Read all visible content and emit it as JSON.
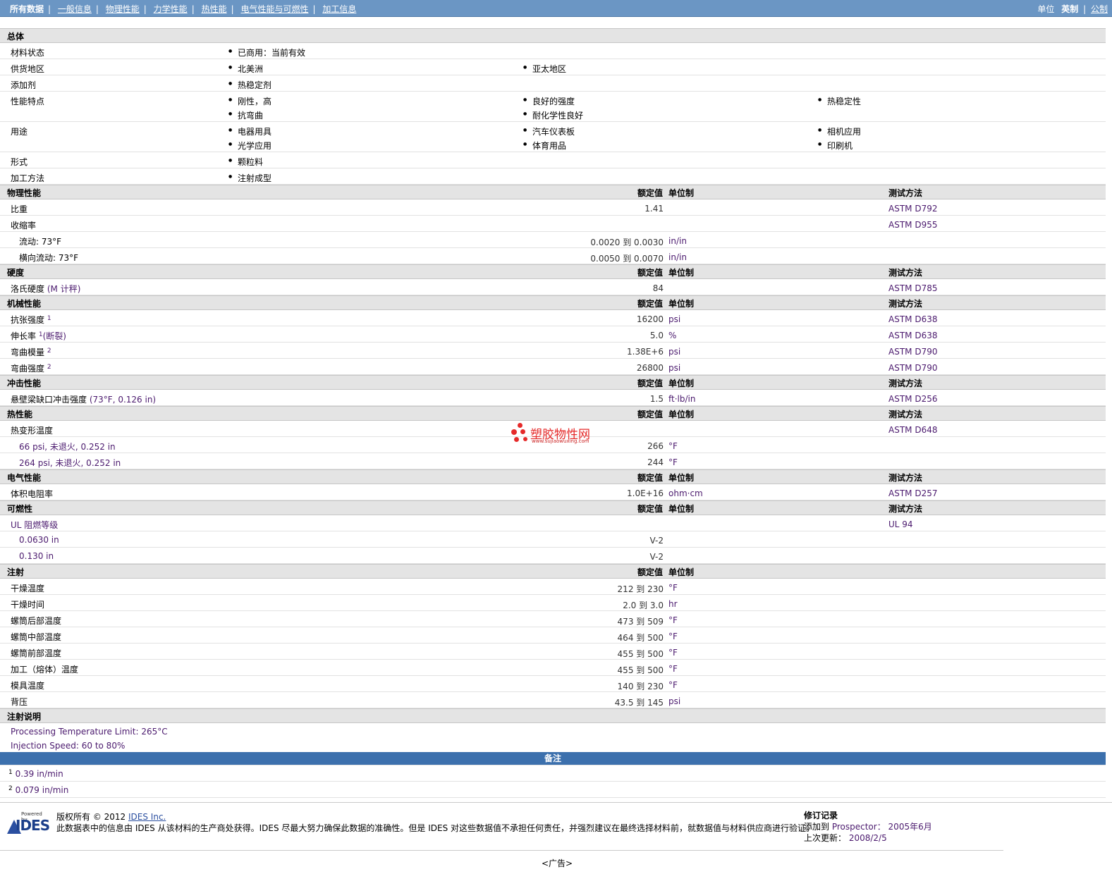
{
  "nav": {
    "items": [
      "所有数据",
      "一般信息",
      "物理性能",
      "力学性能",
      "热性能",
      "电气性能与可燃性",
      "加工信息"
    ],
    "units_label": "单位",
    "unit_current": "英制",
    "unit_other": "公制"
  },
  "headers": {
    "value": "额定值",
    "unit": "单位制",
    "test": "测试方法"
  },
  "general": {
    "title": "总体",
    "rows": [
      {
        "label": "材料状态",
        "items": [
          "已商用：当前有效"
        ]
      },
      {
        "label": "供货地区",
        "items": [
          "北美洲",
          "亚太地区"
        ]
      },
      {
        "label": "添加剂",
        "items": [
          "热稳定剂"
        ]
      },
      {
        "label": "性能特点",
        "items": [
          "刚性，高",
          "良好的强度",
          "热稳定性",
          "抗弯曲",
          "耐化学性良好"
        ]
      },
      {
        "label": "用途",
        "items": [
          "电器用具",
          "汽车仪表板",
          "相机应用",
          "光学应用",
          "体育用品",
          "印刷机"
        ]
      },
      {
        "label": "形式",
        "items": [
          "颗粒料"
        ]
      },
      {
        "label": "加工方法",
        "items": [
          "注射成型"
        ]
      }
    ]
  },
  "physical": {
    "title": "物理性能",
    "rows": [
      {
        "label": "比重",
        "value": "1.41",
        "unit": "",
        "test": "ASTM D792"
      },
      {
        "label": "收缩率",
        "value": "",
        "unit": "",
        "test": "ASTM D955"
      },
      {
        "label": "流动: 73°F",
        "value": "0.0020 到  0.0030",
        "unit": "in/in",
        "test": ""
      },
      {
        "label": "横向流动: 73°F",
        "value": "0.0050 到  0.0070",
        "unit": "in/in",
        "test": ""
      }
    ]
  },
  "hardness": {
    "title": "硬度",
    "rows": [
      {
        "label": "洛氏硬度",
        "extra": "(M 计秤)",
        "value": "84",
        "unit": "",
        "test": "ASTM D785"
      }
    ]
  },
  "mechanical": {
    "title": "机械性能",
    "rows": [
      {
        "label": "抗张强度",
        "sup": "1",
        "extra": "",
        "value": "16200",
        "unit": "psi",
        "test": "ASTM D638"
      },
      {
        "label": "伸长率",
        "sup": "1",
        "extra": "(断裂)",
        "value": "5.0",
        "unit": "%",
        "test": "ASTM D638"
      },
      {
        "label": "弯曲模量",
        "sup": "2",
        "extra": "",
        "value": "1.38E+6",
        "unit": "psi",
        "test": "ASTM D790"
      },
      {
        "label": "弯曲强度",
        "sup": "2",
        "extra": "",
        "value": "26800",
        "unit": "psi",
        "test": "ASTM D790"
      }
    ]
  },
  "impact": {
    "title": "冲击性能",
    "rows": [
      {
        "label": "悬壁梁缺口冲击强度",
        "extra": "(73°F, 0.126 in)",
        "value": "1.5",
        "unit": "ft·lb/in",
        "test": "ASTM D256"
      }
    ]
  },
  "thermal": {
    "title": "热性能",
    "rows": [
      {
        "label": "热变形温度",
        "value": "",
        "unit": "",
        "test": "ASTM D648"
      },
      {
        "label": "66 psi, 未退火, 0.252 in",
        "value": "266",
        "unit": "°F",
        "test": ""
      },
      {
        "label": "264 psi, 未退火, 0.252 in",
        "value": "244",
        "unit": "°F",
        "test": ""
      }
    ]
  },
  "electrical": {
    "title": "电气性能",
    "rows": [
      {
        "label": "体积电阻率",
        "value": "1.0E+16",
        "unit": "ohm·cm",
        "test": "ASTM D257"
      }
    ]
  },
  "flammability": {
    "title": "可燃性",
    "rows": [
      {
        "label": "UL 阻燃等级",
        "value": "",
        "unit": "",
        "test": "UL 94"
      },
      {
        "label": "0.0630 in",
        "value": "V-2",
        "unit": "",
        "test": ""
      },
      {
        "label": "0.130 in",
        "value": "V-2",
        "unit": "",
        "test": ""
      }
    ]
  },
  "injection": {
    "title": "注射",
    "rows": [
      {
        "label": "干燥温度",
        "value": "212 到  230",
        "unit": "°F"
      },
      {
        "label": "干燥时间",
        "value": "2.0 到  3.0",
        "unit": "hr"
      },
      {
        "label": "螺筒后部温度",
        "value": "473 到  509",
        "unit": "°F"
      },
      {
        "label": "螺筒中部温度",
        "value": "464 到  500",
        "unit": "°F"
      },
      {
        "label": "螺筒前部温度",
        "value": "455 到  500",
        "unit": "°F"
      },
      {
        "label": "加工（熔体）温度",
        "value": "455 到  500",
        "unit": "°F"
      },
      {
        "label": "模具温度",
        "value": "140 到  230",
        "unit": "°F"
      },
      {
        "label": "背压",
        "value": "43.5 到  145",
        "unit": "psi"
      }
    ]
  },
  "injection_notes": {
    "title": "注射说明",
    "lines": [
      "Processing Temperature Limit: 265°C",
      "Injection Speed: 60 to 80%"
    ]
  },
  "notes": {
    "title": "备注",
    "items": [
      {
        "sup": "1",
        "text": "0.39 in/min"
      },
      {
        "sup": "2",
        "text": "0.079 in/min"
      }
    ]
  },
  "footer": {
    "logo_powered": "Powered by",
    "logo_text": "IDES",
    "copyright_prefix": "版权所有 © 2012",
    "copyright_link": "IDES Inc.",
    "disclaimer": "此数据表中的信息由 IDES 从该材料的生产商处获得。IDES 尽最大努力确保此数据的准确性。但是 IDES 对这些数据值不承担任何责任，并强烈建议在最终选择材料前，就数据值与材料供应商进行验证。",
    "revision_title": "修订记录",
    "added_label": "添加到",
    "added_source": "Prospector：",
    "added_date": "2005年6月",
    "updated_label": "上次更新：",
    "updated_date": "2008/2/5",
    "ad": "<广告>"
  },
  "watermark": {
    "text": "塑胶物性网",
    "url": "www.sujiaowuxing.com",
    "color": "#e52a2a"
  }
}
